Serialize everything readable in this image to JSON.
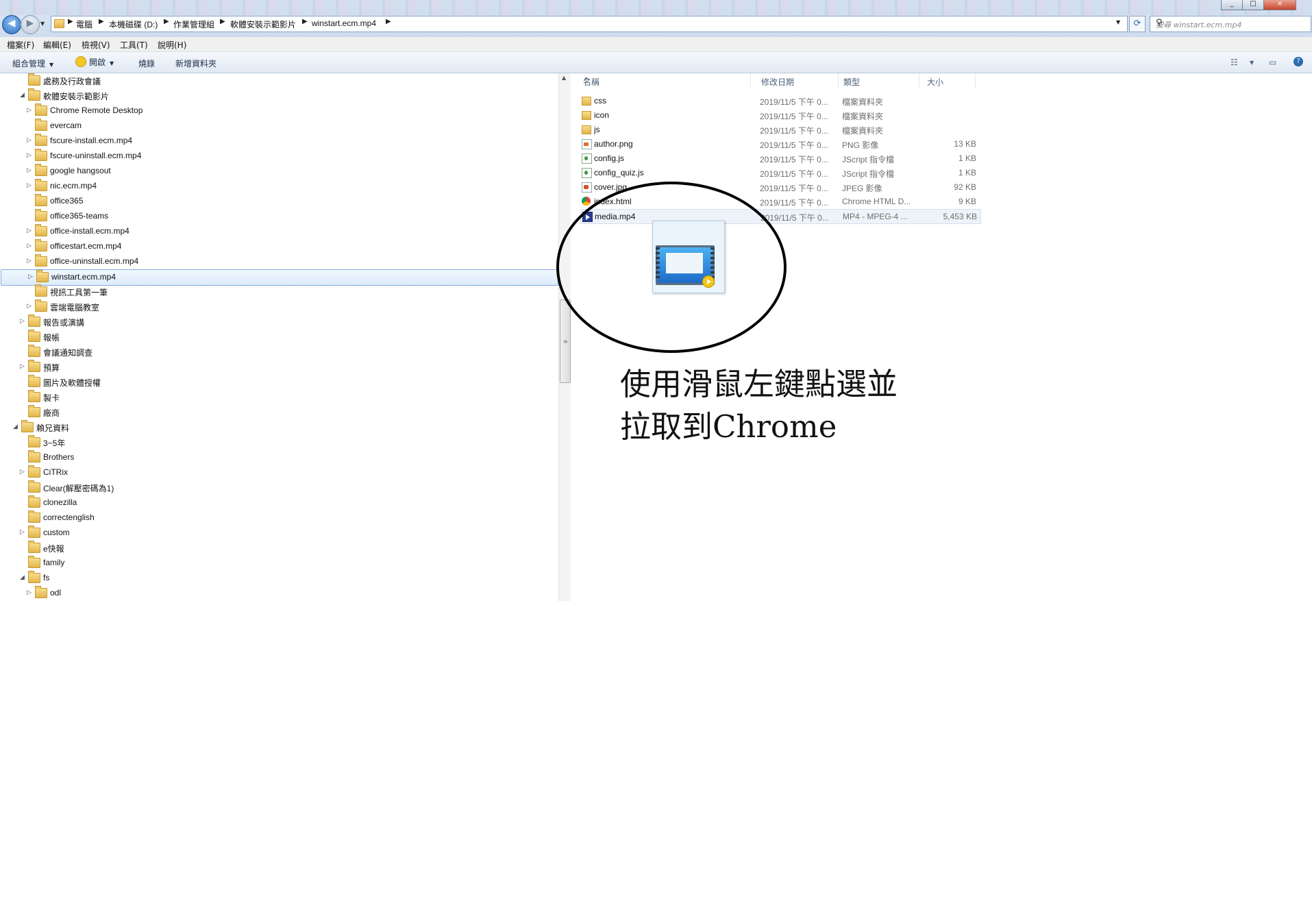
{
  "window": {
    "minimize_label": "_",
    "maximize_label": "□",
    "close_label": "×"
  },
  "address_bar": {
    "back_glyph": "◀",
    "forward_glyph": "▶",
    "crumbs": [
      "電腦",
      "本機磁碟 (D:)",
      "作業管理組",
      "軟體安裝示範影片",
      "winstart.ecm.mp4"
    ],
    "refresh_glyph": "⟳",
    "search_placeholder": "搜尋 winstart.ecm.mp4",
    "search_icon": "search-icon"
  },
  "menubar": [
    "檔案(F)",
    "編輯(E)",
    "檢視(V)",
    "工具(T)",
    "說明(H)"
  ],
  "command_bar": {
    "organize": "組合管理",
    "open": "開啟",
    "burn": "燒錄",
    "new_folder": "新增資料夾",
    "view_glyph": "☷",
    "pane_glyph": "▭",
    "help_glyph": "?"
  },
  "nav_tree": [
    {
      "label": "處務及行政會議",
      "level": 1,
      "expander": "",
      "selected": false
    },
    {
      "label": "軟體安裝示範影片",
      "level": 1,
      "expander": "◢",
      "selected": false
    },
    {
      "label": "Chrome Remote Desktop",
      "level": 2,
      "expander": "▷",
      "selected": false
    },
    {
      "label": "evercam",
      "level": 2,
      "expander": "",
      "selected": false
    },
    {
      "label": "fscure-install.ecm.mp4",
      "level": 2,
      "expander": "▷",
      "selected": false
    },
    {
      "label": "fscure-uninstall.ecm.mp4",
      "level": 2,
      "expander": "▷",
      "selected": false
    },
    {
      "label": "google hangsout",
      "level": 2,
      "expander": "▷",
      "selected": false
    },
    {
      "label": "nic.ecm.mp4",
      "level": 2,
      "expander": "▷",
      "selected": false
    },
    {
      "label": "office365",
      "level": 2,
      "expander": "",
      "selected": false
    },
    {
      "label": "office365-teams",
      "level": 2,
      "expander": "",
      "selected": false
    },
    {
      "label": "office-install.ecm.mp4",
      "level": 2,
      "expander": "▷",
      "selected": false
    },
    {
      "label": "officestart.ecm.mp4",
      "level": 2,
      "expander": "▷",
      "selected": false
    },
    {
      "label": "office-uninstall.ecm.mp4",
      "level": 2,
      "expander": "▷",
      "selected": false
    },
    {
      "label": "winstart.ecm.mp4",
      "level": 2,
      "expander": "▷",
      "selected": true
    },
    {
      "label": "視訊工具第一筆",
      "level": 2,
      "expander": "",
      "selected": false
    },
    {
      "label": "雲端電腦教室",
      "level": 2,
      "expander": "▷",
      "selected": false
    },
    {
      "label": "報告或演講",
      "level": 1,
      "expander": "▷",
      "selected": false
    },
    {
      "label": "報帳",
      "level": 1,
      "expander": "",
      "selected": false
    },
    {
      "label": "會議通知調查",
      "level": 1,
      "expander": "",
      "selected": false
    },
    {
      "label": "預算",
      "level": 1,
      "expander": "▷",
      "selected": false
    },
    {
      "label": "圖片及軟體授權",
      "level": 1,
      "expander": "",
      "selected": false
    },
    {
      "label": "製卡",
      "level": 1,
      "expander": "",
      "selected": false
    },
    {
      "label": "廠商",
      "level": 1,
      "expander": "",
      "selected": false
    },
    {
      "label": "賴兄資料",
      "level": 0,
      "expander": "◢",
      "selected": false
    },
    {
      "label": "3~5年",
      "level": 1,
      "expander": "",
      "selected": false
    },
    {
      "label": "Brothers",
      "level": 1,
      "expander": "",
      "selected": false
    },
    {
      "label": "CiTRix",
      "level": 1,
      "expander": "▷",
      "selected": false
    },
    {
      "label": "Clear(解壓密碼為1)",
      "level": 1,
      "expander": "",
      "selected": false
    },
    {
      "label": "clonezilla",
      "level": 1,
      "expander": "",
      "selected": false
    },
    {
      "label": "correctenglish",
      "level": 1,
      "expander": "",
      "selected": false
    },
    {
      "label": "custom",
      "level": 1,
      "expander": "▷",
      "selected": false
    },
    {
      "label": "e快報",
      "level": 1,
      "expander": "",
      "selected": false
    },
    {
      "label": "family",
      "level": 1,
      "expander": "",
      "selected": false
    },
    {
      "label": "fs",
      "level": 1,
      "expander": "◢",
      "selected": false
    },
    {
      "label": "odl",
      "level": 2,
      "expander": "▷",
      "selected": false
    }
  ],
  "columns": {
    "name": "名稱",
    "modified": "修改日期",
    "type": "類型",
    "size": "大小",
    "sort_glyph": "^"
  },
  "files": [
    {
      "name": "css",
      "icon": "folder",
      "modified": "2019/11/5 下午 0...",
      "type": "檔案資料夾",
      "size": ""
    },
    {
      "name": "icon",
      "icon": "folder",
      "modified": "2019/11/5 下午 0...",
      "type": "檔案資料夾",
      "size": ""
    },
    {
      "name": "js",
      "icon": "folder",
      "modified": "2019/11/5 下午 0...",
      "type": "檔案資料夾",
      "size": ""
    },
    {
      "name": "author.png",
      "icon": "png",
      "modified": "2019/11/5 下午 0...",
      "type": "PNG 影像",
      "size": "13 KB"
    },
    {
      "name": "config.js",
      "icon": "js",
      "modified": "2019/11/5 下午 0...",
      "type": "JScript 指令檔",
      "size": "1 KB"
    },
    {
      "name": "config_quiz.js",
      "icon": "js",
      "modified": "2019/11/5 下午 0...",
      "type": "JScript 指令檔",
      "size": "1 KB"
    },
    {
      "name": "cover.jpg",
      "icon": "jpg",
      "modified": "2019/11/5 下午 0...",
      "type": "JPEG 影像",
      "size": "92 KB"
    },
    {
      "name": "index.html",
      "icon": "html",
      "modified": "2019/11/5 下午 0...",
      "type": "Chrome HTML D...",
      "size": "9 KB"
    },
    {
      "name": "media.mp4",
      "icon": "mp4",
      "modified": "2019/11/5 下午 0...",
      "type": "MP4 - MPEG-4 ...",
      "size": "5,453 KB"
    }
  ],
  "annotation": {
    "line1": "使用滑鼠左鍵點選並",
    "line2": "拉取到Chrome"
  }
}
